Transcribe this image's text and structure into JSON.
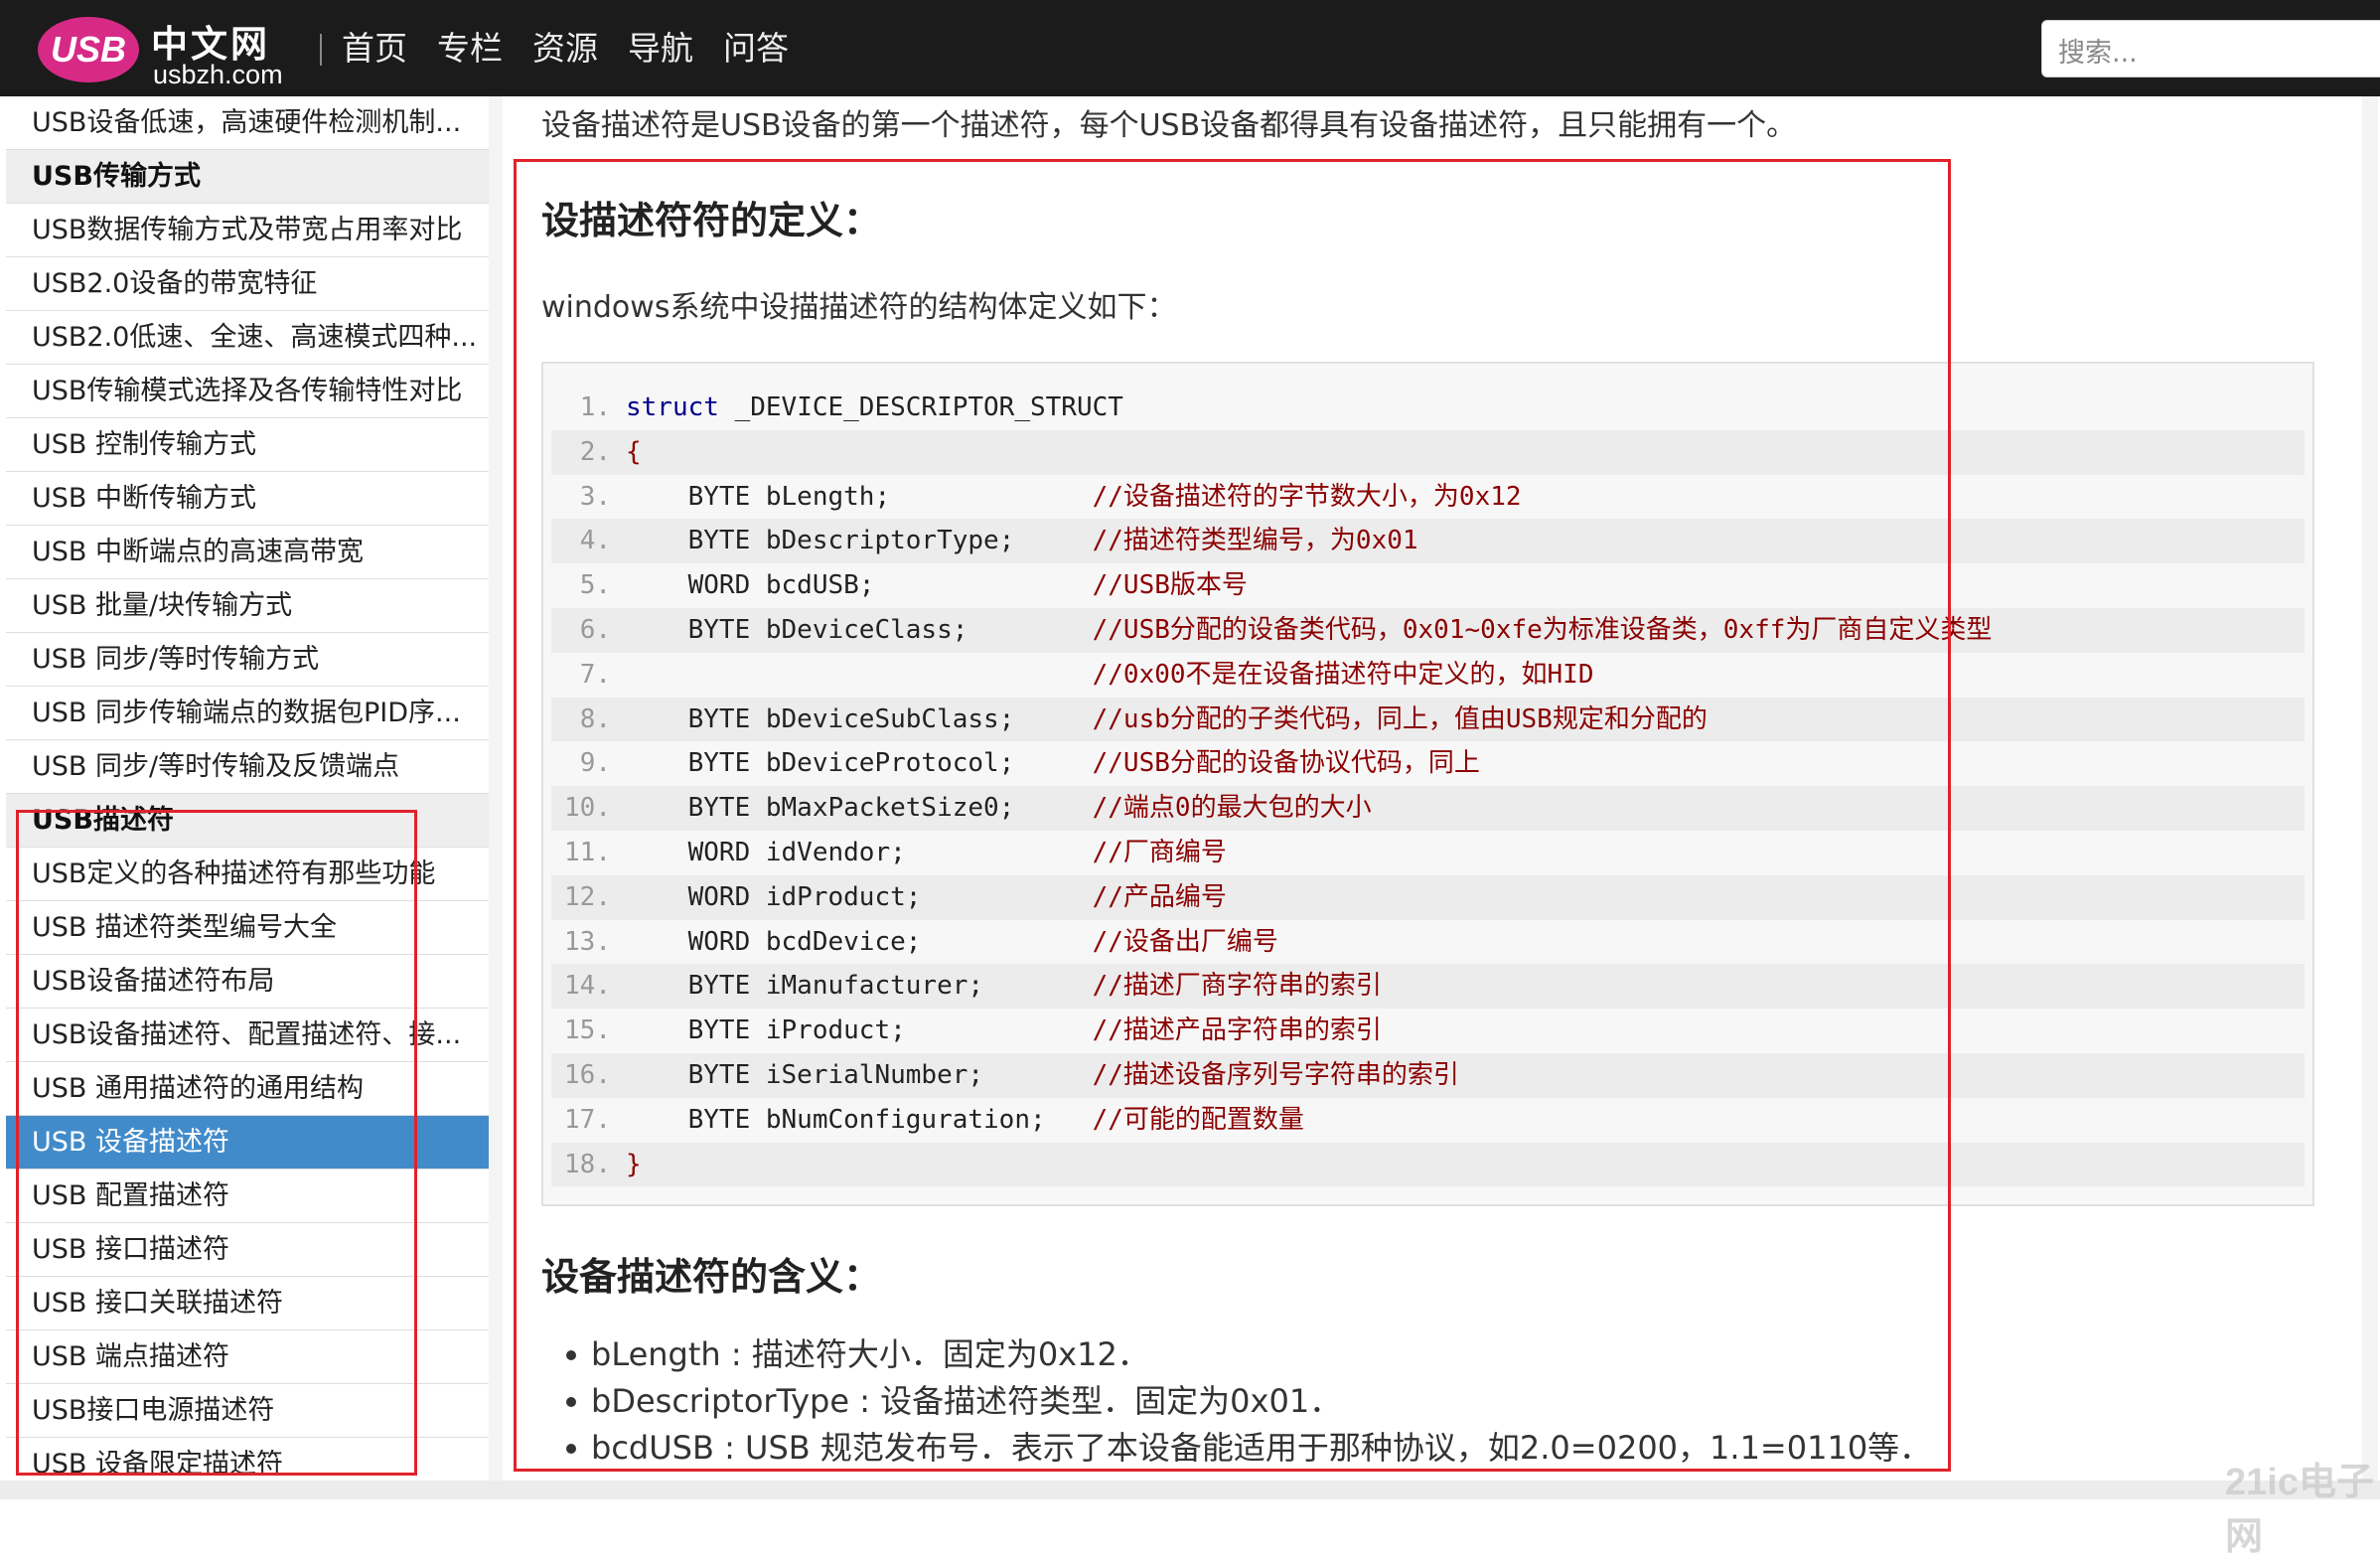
{
  "header": {
    "logo_text": "USB",
    "logo_cn": "中文网",
    "logo_domain": "usbzh.com",
    "nav": [
      "首页",
      "专栏",
      "资源",
      "导航",
      "问答"
    ],
    "search_placeholder": "搜索..."
  },
  "sidebar": {
    "items": [
      {
        "label": "USB设备低速，高速硬件检测机制...",
        "type": "item"
      },
      {
        "label": "USB传输方式",
        "type": "header"
      },
      {
        "label": "USB数据传输方式及带宽占用率对比",
        "type": "item"
      },
      {
        "label": "USB2.0设备的带宽特征",
        "type": "item"
      },
      {
        "label": "USB2.0低速、全速、高速模式四种...",
        "type": "item"
      },
      {
        "label": "USB传输模式选择及各传输特性对比",
        "type": "item"
      },
      {
        "label": "USB 控制传输方式",
        "type": "item"
      },
      {
        "label": "USB 中断传输方式",
        "type": "item"
      },
      {
        "label": "USB 中断端点的高速高带宽",
        "type": "item"
      },
      {
        "label": "USB 批量/块传输方式",
        "type": "item"
      },
      {
        "label": "USB 同步/等时传输方式",
        "type": "item"
      },
      {
        "label": "USB 同步传输端点的数据包PID序...",
        "type": "item"
      },
      {
        "label": "USB 同步/等时传输及反馈端点",
        "type": "item"
      },
      {
        "label": "USB描述符",
        "type": "header"
      },
      {
        "label": "USB定义的各种描述符有那些功能",
        "type": "item"
      },
      {
        "label": "USB 描述符类型编号大全",
        "type": "item"
      },
      {
        "label": "USB设备描述符布局",
        "type": "item"
      },
      {
        "label": "USB设备描述符、配置描述符、接...",
        "type": "item"
      },
      {
        "label": "USB 通用描述符的通用结构",
        "type": "item"
      },
      {
        "label": "USB 设备描述符",
        "type": "active"
      },
      {
        "label": "USB 配置描述符",
        "type": "item"
      },
      {
        "label": "USB 接口描述符",
        "type": "item"
      },
      {
        "label": "USB 接口关联描述符",
        "type": "item"
      },
      {
        "label": "USB 端点描述符",
        "type": "item"
      },
      {
        "label": "USB接口电源描述符",
        "type": "item"
      },
      {
        "label": "USB 设备限定描述符",
        "type": "item"
      }
    ]
  },
  "content": {
    "intro": "设备描述符是USB设备的第一个描述符，每个USB设备都得具有设备描述符，且只能拥有一个。",
    "heading_def": "设描述符符的定义：",
    "para": "windows系统中设描描述符的结构体定义如下：",
    "code": [
      {
        "n": "1.",
        "kw": "struct",
        "code": " _DEVICE_DESCRIPTOR_STRUCT",
        "comment": ""
      },
      {
        "n": "2.",
        "brace": "{",
        "code": "",
        "comment": ""
      },
      {
        "n": "3.",
        "code": "    BYTE bLength;             ",
        "comment": "//设备描述符的字节数大小，为0x12"
      },
      {
        "n": "4.",
        "code": "    BYTE bDescriptorType;     ",
        "comment": "//描述符类型编号，为0x01"
      },
      {
        "n": "5.",
        "code": "    WORD bcdUSB;              ",
        "comment": "//USB版本号"
      },
      {
        "n": "6.",
        "code": "    BYTE bDeviceClass;        ",
        "comment": "//USB分配的设备类代码，0x01~0xfe为标准设备类，0xff为厂商自定义类型"
      },
      {
        "n": "7.",
        "code": "                              ",
        "comment": "//0x00不是在设备描述符中定义的，如HID"
      },
      {
        "n": "8.",
        "code": "    BYTE bDeviceSubClass;     ",
        "comment": "//usb分配的子类代码，同上，值由USB规定和分配的"
      },
      {
        "n": "9.",
        "code": "    BYTE bDeviceProtocol;     ",
        "comment": "//USB分配的设备协议代码，同上"
      },
      {
        "n": "10.",
        "code": "    BYTE bMaxPacketSize0;     ",
        "comment": "//端点0的最大包的大小"
      },
      {
        "n": "11.",
        "code": "    WORD idVendor;            ",
        "comment": "//厂商编号"
      },
      {
        "n": "12.",
        "code": "    WORD idProduct;           ",
        "comment": "//产品编号"
      },
      {
        "n": "13.",
        "code": "    WORD bcdDevice;           ",
        "comment": "//设备出厂编号"
      },
      {
        "n": "14.",
        "code": "    BYTE iManufacturer;       ",
        "comment": "//描述厂商字符串的索引"
      },
      {
        "n": "15.",
        "code": "    BYTE iProduct;            ",
        "comment": "//描述产品字符串的索引"
      },
      {
        "n": "16.",
        "code": "    BYTE iSerialNumber;       ",
        "comment": "//描述设备序列号字符串的索引"
      },
      {
        "n": "17.",
        "code": "    BYTE bNumConfiguration;   ",
        "comment": "//可能的配置数量"
      },
      {
        "n": "18.",
        "brace": "}",
        "code": "",
        "comment": ""
      }
    ],
    "heading_meaning": "设备描述符的含义：",
    "bullets": [
      "bLength : 描述符大小．固定为0x12．",
      "bDescriptorType : 设备描述符类型．固定为0x01．",
      "bcdUSB : USB 规范发布号．表示了本设备能适用于那种协议，如2.0=0200，1.1=0110等．"
    ]
  },
  "watermark": "21ic电子网",
  "colors": {
    "nav_bg": "#1b1b1b",
    "logo_pink": "#d62a86",
    "active_item": "#428bca",
    "annotation_red": "#e0222a",
    "keyword": "#00008b",
    "comment": "#8b0000"
  }
}
